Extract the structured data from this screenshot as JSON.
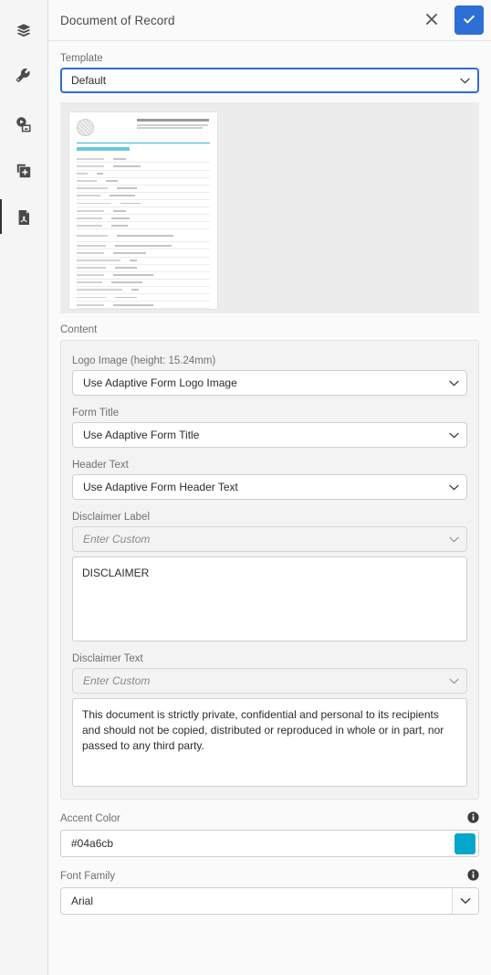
{
  "rail": {
    "items": [
      {
        "name": "layers-icon",
        "label": "Content tree",
        "selected": false
      },
      {
        "name": "wrench-icon",
        "label": "Component properties",
        "selected": false
      },
      {
        "name": "assets-icon",
        "label": "Assets",
        "selected": false
      },
      {
        "name": "add-component-icon",
        "label": "Components",
        "selected": false
      },
      {
        "name": "pdf-icon",
        "label": "Document of Record",
        "selected": true
      }
    ]
  },
  "header": {
    "title": "Document of Record",
    "close_label": "Cancel",
    "confirm_label": "Done",
    "confirm_color": "#2d6fd4"
  },
  "template": {
    "label": "Template",
    "value": "Default"
  },
  "preview": {
    "label": "Document of Record preview"
  },
  "content": {
    "group_label": "Content",
    "fields": [
      {
        "label": "Logo Image (height: 15.24mm)",
        "value": "Use Adaptive Form Logo Image"
      },
      {
        "label": "Form Title",
        "value": "Use Adaptive Form Title"
      },
      {
        "label": "Header Text",
        "value": "Use Adaptive Form Header Text"
      }
    ],
    "disclaimer_label": {
      "label": "Disclaimer Label",
      "placeholder": "Enter Custom",
      "text": "DISCLAIMER"
    },
    "disclaimer_text": {
      "label": "Disclaimer Text",
      "placeholder": "Enter Custom",
      "text": "This document is strictly private, confidential and personal to its recipients and should not be copied, distributed or reproduced in whole or in part, nor passed to any third party."
    }
  },
  "accent_color": {
    "label": "Accent Color",
    "value": "#04a6cb",
    "swatch_color": "#04a6cb",
    "info_label": "More information"
  },
  "font_family": {
    "label": "Font Family",
    "value": "Arial",
    "info_label": "More information"
  }
}
